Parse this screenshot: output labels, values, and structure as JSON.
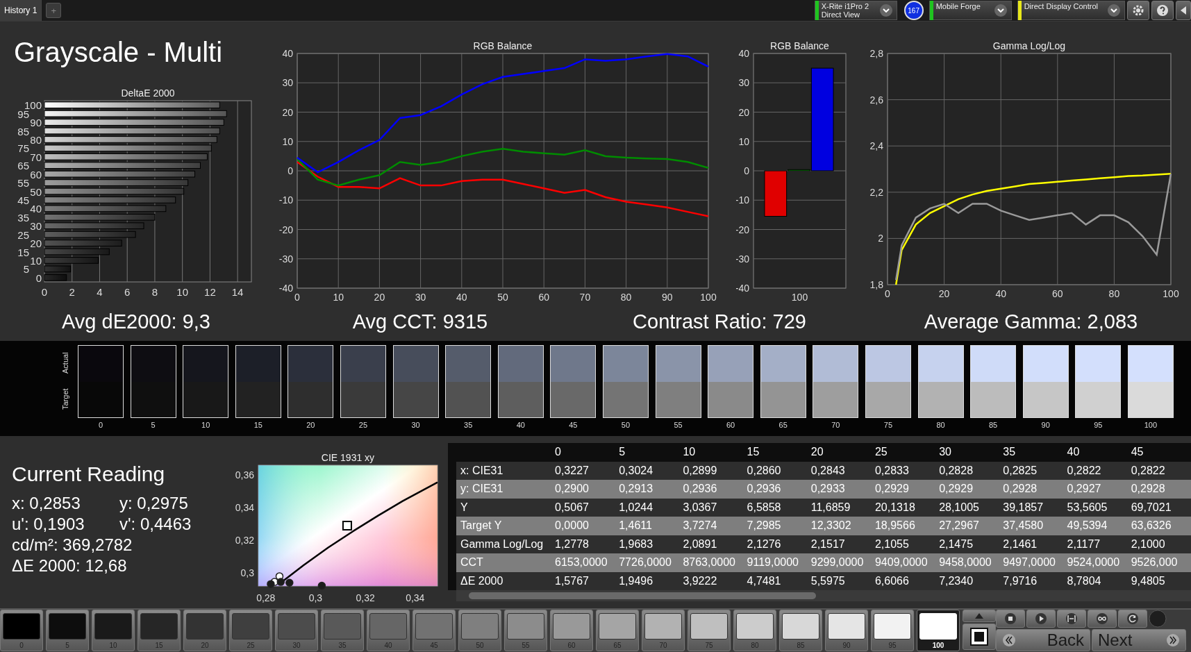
{
  "top_bar": {
    "tabs": [
      {
        "label": "History 1",
        "selected": true
      }
    ],
    "add_tab": "+",
    "controls": [
      {
        "kind": "dropdown",
        "label": "X-Rite i1Pro 2",
        "sublabel": "Direct View",
        "color": "#1fc41f"
      },
      {
        "kind": "badge",
        "label": "167"
      },
      {
        "kind": "dropdown",
        "label": "Mobile Forge",
        "color": "#1fc41f"
      },
      {
        "kind": "dropdown",
        "label": "Direct Display Control",
        "color": "#e8e81a"
      }
    ]
  },
  "title": "Grayscale - Multi",
  "charts": [
    {
      "chart_data": {
        "type": "bar",
        "orientation": "horizontal",
        "title": "DeltaE 2000",
        "grid": true,
        "categories": [
          "100",
          "95",
          "90",
          "85",
          "80",
          "75",
          "70",
          "65",
          "60",
          "55",
          "50",
          "45",
          "40",
          "35",
          "30",
          "25",
          "20",
          "15",
          "10",
          "5",
          "0"
        ],
        "values": [
          12.7,
          13.2,
          13.0,
          12.7,
          12.5,
          12.1,
          11.8,
          11.3,
          10.9,
          10.4,
          10.1,
          9.5,
          8.8,
          8.0,
          7.2,
          6.6,
          5.6,
          4.7,
          3.9,
          1.9,
          1.6
        ],
        "xlim": [
          0,
          15
        ],
        "xticks": [
          0,
          2,
          4,
          6,
          8,
          10,
          12,
          14
        ]
      }
    },
    {
      "chart_data": {
        "type": "line",
        "title": "RGB Balance",
        "grid": true,
        "x": [
          0,
          5,
          10,
          15,
          20,
          25,
          30,
          35,
          40,
          45,
          50,
          55,
          60,
          65,
          70,
          75,
          80,
          85,
          90,
          95,
          100
        ],
        "series": [
          {
            "color": "#ff0000",
            "values": [
              3,
              -2,
              -5.5,
              -5.5,
              -6,
              -2.5,
              -5,
              -5,
              -3.5,
              -3,
              -3,
              -4.5,
              -6,
              -7.5,
              -6.5,
              -9,
              -10.5,
              -11.5,
              -12.5,
              -14,
              -15.5
            ]
          },
          {
            "color": "#008c00",
            "values": [
              4,
              -3,
              -5,
              -3,
              -1.5,
              3,
              2,
              3,
              5,
              6.5,
              7.5,
              6.5,
              6,
              5.5,
              7,
              5,
              4.5,
              4.2,
              4,
              3,
              1
            ]
          },
          {
            "color": "#0000ff",
            "values": [
              4.5,
              -0.5,
              3,
              7,
              10.5,
              18,
              19,
              22,
              26,
              29.5,
              32,
              33,
              34,
              35,
              38,
              37.5,
              38,
              39,
              39.8,
              39,
              35.5
            ]
          }
        ],
        "xlim": [
          0,
          100
        ],
        "ylim": [
          -40,
          40
        ],
        "xticks": [
          0,
          10,
          20,
          30,
          40,
          50,
          60,
          70,
          80,
          90,
          100
        ],
        "yticks": [
          -40,
          -30,
          -20,
          -10,
          0,
          10,
          20,
          30,
          40
        ]
      }
    },
    {
      "chart_data": {
        "type": "bar",
        "title": "RGB Balance",
        "grid": true,
        "categories": [
          "100"
        ],
        "series": [
          {
            "color": "#e00000",
            "values": [
              -15.5
            ]
          },
          {
            "color": "#00a000",
            "values": [
              0.4
            ]
          },
          {
            "color": "#0000e0",
            "values": [
              35
            ]
          }
        ],
        "ylim": [
          -40,
          40
        ],
        "yticks": [
          -40,
          -30,
          -20,
          -10,
          0,
          10,
          20,
          30,
          40
        ]
      }
    },
    {
      "chart_data": {
        "type": "line",
        "title": "Gamma Log/Log",
        "grid": true,
        "x": [
          3,
          5,
          10,
          15,
          20,
          25,
          30,
          35,
          40,
          45,
          50,
          55,
          60,
          65,
          70,
          75,
          80,
          85,
          90,
          95,
          100
        ],
        "series": [
          {
            "color": "#ffff00",
            "values": [
              1.8,
              1.95,
              2.06,
              2.11,
              2.14,
              2.17,
              2.19,
              2.205,
              2.215,
              2.225,
              2.235,
              2.24,
              2.245,
              2.25,
              2.255,
              2.26,
              2.265,
              2.27,
              2.272,
              2.276,
              2.28
            ]
          },
          {
            "color": "#9a9a9a",
            "values": [
              1.82,
              1.97,
              2.09,
              2.13,
              2.15,
              2.11,
              2.15,
              2.15,
              2.12,
              2.1,
              2.08,
              2.09,
              2.1,
              2.11,
              2.06,
              2.1,
              2.1,
              2.07,
              2.01,
              1.93,
              2.28
            ]
          }
        ],
        "xlim": [
          0,
          100
        ],
        "ylim": [
          1.8,
          2.8
        ],
        "xticks": [
          0,
          20,
          40,
          60,
          80,
          100
        ],
        "yticks": [
          {
            "value": 1.8,
            "label": "1,8"
          },
          {
            "value": 2,
            "label": "2"
          },
          {
            "value": 2.2,
            "label": "2,2"
          },
          {
            "value": 2.4,
            "label": "2,4"
          },
          {
            "value": 2.6,
            "label": "2,6"
          },
          {
            "value": 2.8,
            "label": "2,8"
          }
        ]
      }
    }
  ],
  "summary": [
    "Avg dE2000: 9,3",
    "Avg CCT: 9315",
    "Contrast Ratio: 729",
    "Average Gamma: 2,083"
  ],
  "patches": {
    "actual_label": "Actual",
    "target_label": "Target",
    "items": [
      {
        "label": "0",
        "actual": {
          "color": "#0a080d"
        },
        "target": {
          "color": "#080808"
        }
      },
      {
        "label": "5",
        "actual": {
          "color": "#0e0d12"
        },
        "target": {
          "color": "#0f0f0f"
        }
      },
      {
        "label": "10",
        "actual": {
          "color": "#15161d"
        },
        "target": {
          "color": "#181818"
        }
      },
      {
        "label": "15",
        "actual": {
          "color": "#1c1f28"
        },
        "target": {
          "color": "#222222"
        }
      },
      {
        "label": "20",
        "actual": {
          "color": "#2b2f3b"
        },
        "target": {
          "color": "#2e2e2e"
        }
      },
      {
        "label": "25",
        "actual": {
          "color": "#3a3f4c"
        },
        "target": {
          "color": "#3a3a3a"
        }
      },
      {
        "label": "30",
        "actual": {
          "color": "#474d5b"
        },
        "target": {
          "color": "#464646"
        }
      },
      {
        "label": "35",
        "actual": {
          "color": "#555c6b"
        },
        "target": {
          "color": "#525252"
        }
      },
      {
        "label": "40",
        "actual": {
          "color": "#626a7c"
        },
        "target": {
          "color": "#5e5e5e"
        }
      },
      {
        "label": "45",
        "actual": {
          "color": "#6f788b"
        },
        "target": {
          "color": "#696969"
        }
      },
      {
        "label": "50",
        "actual": {
          "color": "#7c869a"
        },
        "target": {
          "color": "#747474"
        }
      },
      {
        "label": "55",
        "actual": {
          "color": "#8a94a9"
        },
        "target": {
          "color": "#7f7f7f"
        }
      },
      {
        "label": "60",
        "actual": {
          "color": "#97a1b8"
        },
        "target": {
          "color": "#8a8a8a"
        }
      },
      {
        "label": "65",
        "actual": {
          "color": "#a4afc7"
        },
        "target": {
          "color": "#949494"
        }
      },
      {
        "label": "70",
        "actual": {
          "color": "#b1bcd6"
        },
        "target": {
          "color": "#9e9e9e"
        }
      },
      {
        "label": "75",
        "actual": {
          "color": "#bcc7e3"
        },
        "target": {
          "color": "#a8a8a8"
        }
      },
      {
        "label": "80",
        "actual": {
          "color": "#c6d2ee"
        },
        "target": {
          "color": "#b2b2b2"
        }
      },
      {
        "label": "85",
        "actual": {
          "color": "#cfdbf8"
        },
        "target": {
          "color": "#bcbcbc"
        }
      },
      {
        "label": "90",
        "actual": {
          "color": "#d2defb"
        },
        "target": {
          "color": "#c6c6c6"
        }
      },
      {
        "label": "95",
        "actual": {
          "color": "#d3dffc"
        },
        "target": {
          "color": "#d0d0d0"
        }
      },
      {
        "label": "100",
        "actual": {
          "color": "#d4e0fd"
        },
        "target": {
          "color": "#dadada"
        }
      }
    ]
  },
  "current_reading": {
    "title": "Current Reading",
    "rows": [
      [
        "x: 0,2853",
        "y: 0,2975"
      ],
      [
        "u': 0,1903",
        "v': 0,4463"
      ],
      [
        "cd/m²: 369,2782"
      ],
      [
        "ΔE 2000: 12,68"
      ]
    ]
  },
  "cie_chart": {
    "chart_data": {
      "type": "scatter",
      "title": "CIE 1931 xy",
      "series": [
        {
          "type": "line",
          "color": "#000000",
          "x": [
            0.2865,
            0.295,
            0.305,
            0.315,
            0.325,
            0.335,
            0.349
          ],
          "values": [
            0.2945,
            0.3045,
            0.3155,
            0.3255,
            0.335,
            0.344,
            0.3555
          ]
        },
        {
          "color": "#ffffff",
          "marker": "circle",
          "x": [
            0.2835,
            0.2855
          ],
          "values": [
            0.2945,
            0.298
          ]
        },
        {
          "color": "#1c1c1c",
          "marker": "circle",
          "x": [
            0.282,
            0.286,
            0.2895,
            0.3025
          ],
          "values": [
            0.2932,
            0.2945,
            0.294,
            0.2922
          ]
        },
        {
          "color": "#ffffff",
          "marker": "square",
          "x": [
            0.3127
          ],
          "values": [
            0.329
          ]
        }
      ],
      "xlim": [
        0.277,
        0.349
      ],
      "ylim": [
        0.292,
        0.366
      ],
      "xticks": [
        {
          "value": 0.28,
          "label": "0,28"
        },
        {
          "value": 0.3,
          "label": "0,3"
        },
        {
          "value": 0.32,
          "label": "0,32"
        },
        {
          "value": 0.34,
          "label": "0,34"
        }
      ],
      "yticks": [
        {
          "value": 0.3,
          "label": "0,3"
        },
        {
          "value": 0.32,
          "label": "0,32"
        },
        {
          "value": 0.34,
          "label": "0,34"
        },
        {
          "value": 0.36,
          "label": "0,36"
        }
      ]
    }
  },
  "table": {
    "columns": [
      "0",
      "5",
      "10",
      "15",
      "20",
      "25",
      "30",
      "35",
      "40",
      "45"
    ],
    "rows": [
      {
        "label": "x: CIE31",
        "cells": [
          "0,3227",
          "0,3024",
          "0,2899",
          "0,2860",
          "0,2843",
          "0,2833",
          "0,2828",
          "0,2825",
          "0,2822",
          "0,2822"
        ]
      },
      {
        "label": "y: CIE31",
        "cells": [
          "0,2900",
          "0,2913",
          "0,2936",
          "0,2936",
          "0,2933",
          "0,2929",
          "0,2929",
          "0,2928",
          "0,2927",
          "0,2928"
        ]
      },
      {
        "label": "Y",
        "cells": [
          "0,5067",
          "1,0244",
          "3,0367",
          "6,5858",
          "11,6859",
          "20,1318",
          "28,1005",
          "39,1857",
          "53,5605",
          "69,7021"
        ]
      },
      {
        "label": "Target Y",
        "cells": [
          "0,0000",
          "1,4611",
          "3,7274",
          "7,2985",
          "12,3302",
          "18,9566",
          "27,2967",
          "37,4580",
          "49,5394",
          "63,6326"
        ]
      },
      {
        "label": "Gamma Log/Log",
        "cells": [
          "1,2778",
          "1,9683",
          "2,0891",
          "2,1276",
          "2,1517",
          "2,1055",
          "2,1475",
          "2,1461",
          "2,1177",
          "2,1000"
        ]
      },
      {
        "label": "CCT",
        "cells": [
          "6153,0000",
          "7726,0000",
          "8763,0000",
          "9119,0000",
          "9299,0000",
          "9409,0000",
          "9458,0000",
          "9497,0000",
          "9524,0000",
          "9526,000"
        ]
      },
      {
        "label": "ΔE 2000",
        "cells": [
          "1,5767",
          "1,9496",
          "3,9222",
          "4,7481",
          "5,5975",
          "6,6066",
          "7,2340",
          "7,9716",
          "8,7804",
          "9,4805"
        ]
      }
    ]
  },
  "patch_buttons": [
    {
      "label": "0",
      "color": "#000000",
      "selected": false
    },
    {
      "label": "5",
      "color": "#0d0d0d",
      "selected": false
    },
    {
      "label": "10",
      "color": "#1a1a1a",
      "selected": false
    },
    {
      "label": "15",
      "color": "#262626",
      "selected": false
    },
    {
      "label": "20",
      "color": "#333333",
      "selected": false
    },
    {
      "label": "25",
      "color": "#3f3f3f",
      "selected": false
    },
    {
      "label": "30",
      "color": "#4c4c4c",
      "selected": false
    },
    {
      "label": "35",
      "color": "#595959",
      "selected": false
    },
    {
      "label": "40",
      "color": "#666666",
      "selected": false
    },
    {
      "label": "45",
      "color": "#727272",
      "selected": false
    },
    {
      "label": "50",
      "color": "#7f7f7f",
      "selected": false
    },
    {
      "label": "55",
      "color": "#8c8c8c",
      "selected": false
    },
    {
      "label": "60",
      "color": "#999999",
      "selected": false
    },
    {
      "label": "65",
      "color": "#a5a5a5",
      "selected": false
    },
    {
      "label": "70",
      "color": "#b2b2b2",
      "selected": false
    },
    {
      "label": "75",
      "color": "#bfbfbf",
      "selected": false
    },
    {
      "label": "80",
      "color": "#cccccc",
      "selected": false
    },
    {
      "label": "85",
      "color": "#d8d8d8",
      "selected": false
    },
    {
      "label": "90",
      "color": "#e5e5e5",
      "selected": false
    },
    {
      "label": "95",
      "color": "#f2f2f2",
      "selected": false
    },
    {
      "label": "100",
      "color": "#ffffff",
      "selected": true
    }
  ],
  "navigation": {
    "back": "Back",
    "next": "Next"
  }
}
